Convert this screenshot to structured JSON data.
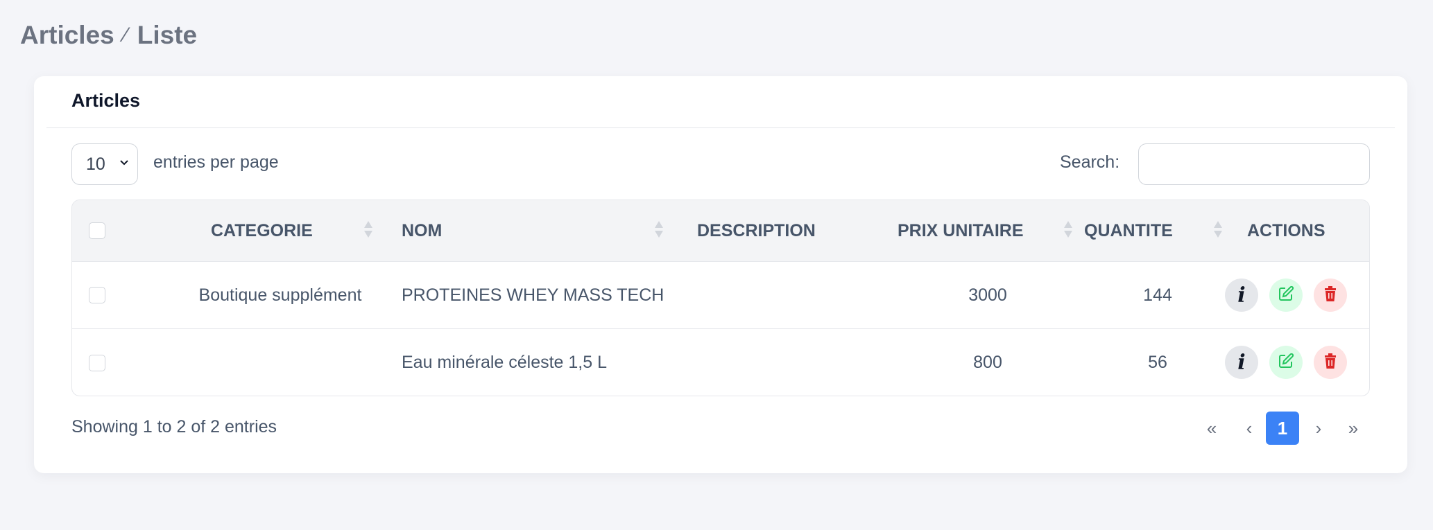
{
  "breadcrumb": {
    "root": "Articles",
    "separator": "⁄",
    "current": "Liste"
  },
  "card": {
    "title": "Articles"
  },
  "controls": {
    "per_page_value": "10",
    "per_page_label": "entries per page",
    "search_label": "Search:",
    "search_value": ""
  },
  "table": {
    "columns": [
      "CATEGORIE",
      "NOM",
      "DESCRIPTION",
      "PRIX UNITAIRE",
      "QUANTITE",
      "ACTIONS"
    ],
    "rows": [
      {
        "categorie": "Boutique supplément",
        "nom": "PROTEINES WHEY MASS TECH",
        "description": "",
        "prix": "3000",
        "quantite": "144"
      },
      {
        "categorie": "",
        "nom": "Eau minérale céleste 1,5 L",
        "description": "",
        "prix": "800",
        "quantite": "56"
      }
    ]
  },
  "footer": {
    "info": "Showing 1 to 2 of 2 entries"
  },
  "pagination": {
    "first": "«",
    "prev": "‹",
    "current": "1",
    "next": "›",
    "last": "»"
  },
  "colors": {
    "accent": "#3b82f6",
    "edit": "#22c55e",
    "delete": "#dc2626"
  },
  "icons": {
    "info": "info-icon",
    "edit": "edit-icon",
    "delete": "trash-icon"
  }
}
